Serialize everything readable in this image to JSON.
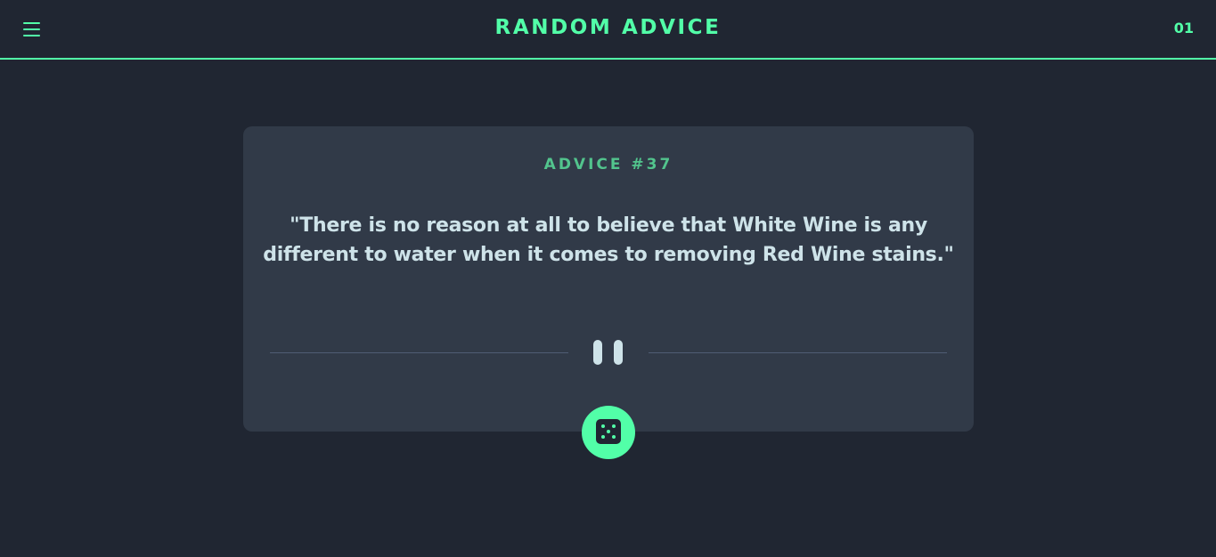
{
  "header": {
    "title": "RANDOM ADVICE",
    "counter": "01",
    "menu_icon": "hamburger-menu-icon"
  },
  "card": {
    "advice_id": "ADVICE #37",
    "quote": "\"There is no reason at all to believe that White Wine is any different to water when it comes to removing Red Wine stains.\"",
    "divider_icon": "pause-icon"
  },
  "dice_button": {
    "icon": "dice-icon"
  },
  "colors": {
    "background": "#202632",
    "card": "#313a48",
    "accent": "#52ffa8",
    "advice_id": "#52c48d",
    "text": "#cee3e9",
    "divider": "#4f5d74"
  }
}
